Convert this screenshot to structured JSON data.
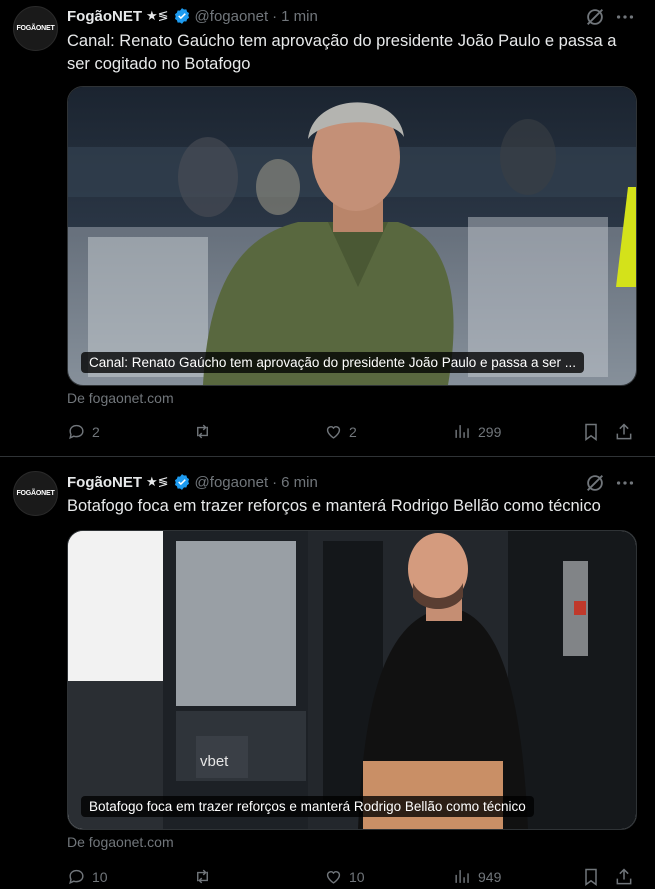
{
  "tweets": [
    {
      "avatar_label": "FOGÃONET",
      "author": "FogãoNET",
      "decoration": "★≶",
      "handle": "@fogaonet",
      "separator": "·",
      "time": "1 min",
      "text": "Canal: Renato Gaúcho tem aprovação do presidente João Paulo e passa a ser cogitado no Botafogo",
      "media_caption": "Canal: Renato Gaúcho tem aprovação do presidente João Paulo e passa a ser ...",
      "source": "De fogaonet.com",
      "replies": "2",
      "reposts": "",
      "likes": "2",
      "views": "299"
    },
    {
      "avatar_label": "FOGÃONET",
      "author": "FogãoNET",
      "decoration": "★≶",
      "handle": "@fogaonet",
      "separator": "·",
      "time": "6 min",
      "text": "Botafogo foca em trazer reforços e manterá Rodrigo Bellão como técnico",
      "media_caption": "Botafogo foca em trazer reforços e manterá Rodrigo Bellão como técnico",
      "source": "De fogaonet.com",
      "replies": "10",
      "reposts": "",
      "likes": "10",
      "views": "949"
    }
  ],
  "icons": [
    "verified-badge-icon",
    "grok-icon",
    "more-icon",
    "reply-icon",
    "repost-icon",
    "like-icon",
    "views-icon",
    "bookmark-icon",
    "share-icon"
  ],
  "colors": {
    "background": "#000000",
    "text": "#e7e9ea",
    "muted": "#71767b",
    "verified": "#1d9bf0",
    "divider": "#2f3336"
  }
}
